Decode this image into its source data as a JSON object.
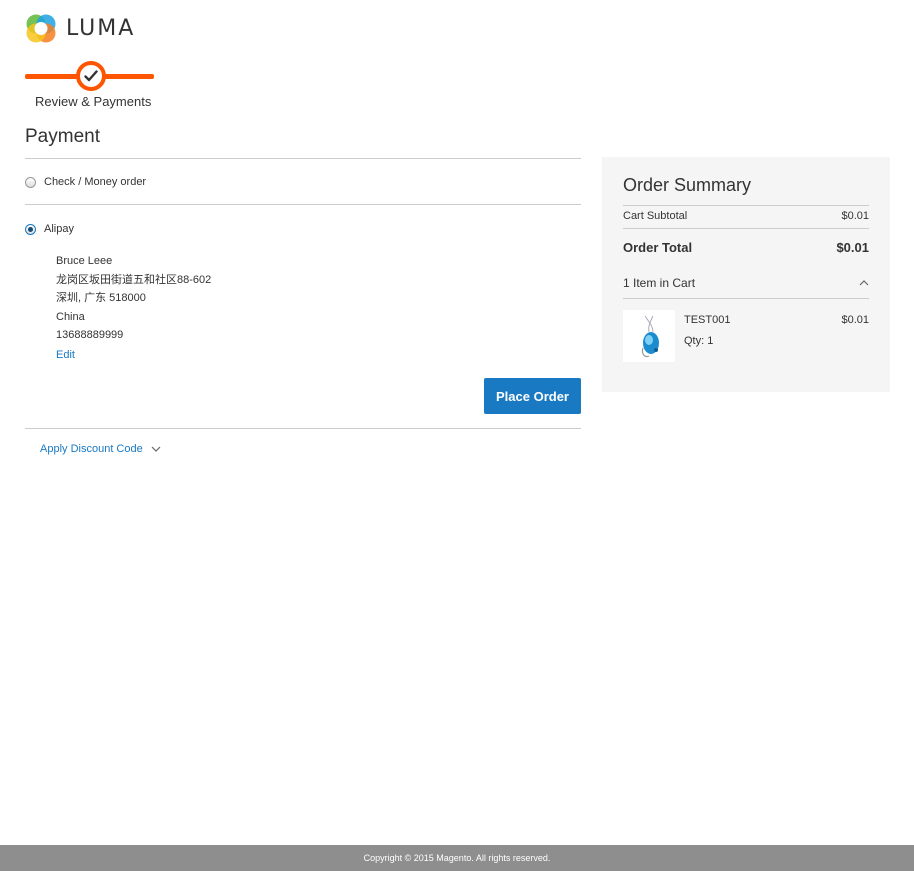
{
  "brand": {
    "name": "LUMA",
    "accent": "#ff5501",
    "link": "#1979c3"
  },
  "progress": {
    "steps": [
      {
        "label": "Review & Payments",
        "state": "current"
      }
    ]
  },
  "payment": {
    "title": "Payment",
    "methods": [
      {
        "label": "Check / Money order",
        "selected": false
      },
      {
        "label": "Alipay",
        "selected": true
      }
    ],
    "billing_address": {
      "name": "Bruce Leee",
      "street": "龙岗区坂田街道五和社区88-602",
      "city_region_postcode": "深圳, 广东 518000",
      "country": "China",
      "phone": "13688889999"
    },
    "edit_label": "Edit",
    "place_order_label": "Place Order",
    "discount_label": "Apply Discount Code"
  },
  "summary": {
    "title": "Order Summary",
    "subtotal_label": "Cart Subtotal",
    "subtotal_value": "$0.01",
    "total_label": "Order Total",
    "total_value": "$0.01",
    "items_label": "1 Item in Cart",
    "items": [
      {
        "name": "TEST001",
        "qty_label": "Qty: 1",
        "price": "$0.01"
      }
    ]
  },
  "footer": {
    "copyright": "Copyright © 2015 Magento. All rights reserved."
  }
}
